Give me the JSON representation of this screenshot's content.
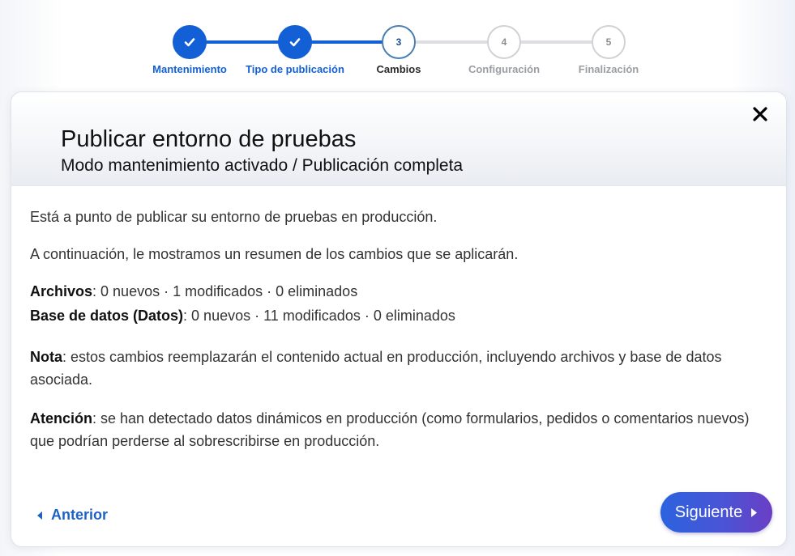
{
  "stepper": {
    "steps": [
      {
        "number": "1",
        "label": "Mantenimiento",
        "state": "done"
      },
      {
        "number": "2",
        "label": "Tipo de publicación",
        "state": "done"
      },
      {
        "number": "3",
        "label": "Cambios",
        "state": "current"
      },
      {
        "number": "4",
        "label": "Configuración",
        "state": "pending"
      },
      {
        "number": "5",
        "label": "Finalización",
        "state": "pending"
      }
    ]
  },
  "dialog": {
    "title": "Publicar entorno de pruebas",
    "subtitle": "Modo mantenimiento activado / Publicación completa",
    "intro": "Está a punto de publicar su entorno de pruebas en producción.",
    "summary_intro": "A continuación, le mostramos un resumen de los cambios que se aplicarán.",
    "files_label": "Archivos",
    "files_value": ": 0 nuevos · 1 modificados · 0 eliminados",
    "db_label": "Base de datos (Datos)",
    "db_value": ": 0 nuevos · 11 modificados · 0 eliminados",
    "note_label": "Nota",
    "note_text": ": estos cambios reemplazarán el contenido actual en producción, incluyendo archivos y base de datos asociada.",
    "warning_label": "Atención",
    "warning_text": ": se han detectado datos dinámicos en producción (como formularios, pedidos o comentarios nuevos) que podrían perderse al sobrescribirse en producción.",
    "prev_label": "Anterior",
    "next_label": "Siguiente"
  },
  "icons": {
    "close": "close-icon",
    "check": "check-icon",
    "prev": "caret-left-icon",
    "next": "caret-right-icon"
  },
  "colors": {
    "primary": "#1360d6",
    "current_step_border": "#4a7fb3",
    "pending": "#d0d2d6",
    "link": "#1e63c4",
    "button_gradient_start": "#2b63df",
    "button_gradient_end": "#6a3fc4"
  }
}
